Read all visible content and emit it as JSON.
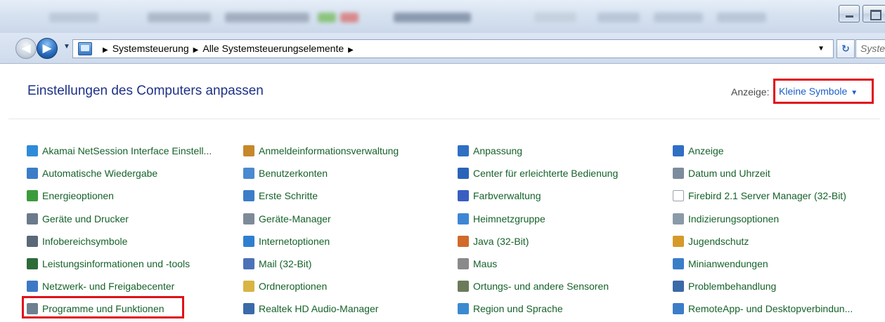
{
  "window": {
    "minimize_icon": "minimize-icon",
    "maximize_icon": "maximize-icon"
  },
  "navigation": {
    "back_glyph": "◀",
    "forward_glyph": "▶",
    "history_glyph": "▼",
    "breadcrumb": [
      "Systemsteuerung",
      "Alle Systemsteuerungselemente"
    ],
    "breadcrumb_separator": "▶",
    "address_dropdown_glyph": "▼",
    "refresh_glyph": "↻",
    "search_placeholder": "System"
  },
  "header": {
    "title": "Einstellungen des Computers anpassen",
    "view_label": "Anzeige:",
    "view_value": "Kleine Symbole",
    "view_caret": "▼"
  },
  "columns": [
    [
      {
        "label": "Akamai NetSession Interface Einstell...",
        "icon": "akamai-icon",
        "color": "#2f8bd8"
      },
      {
        "label": "Automatische Wiedergabe",
        "icon": "autoplay-icon",
        "color": "#3c7dc8"
      },
      {
        "label": "Energieoptionen",
        "icon": "power-options-icon",
        "color": "#3b9c3b"
      },
      {
        "label": "Geräte und Drucker",
        "icon": "printer-icon",
        "color": "#6b7a8c"
      },
      {
        "label": "Infobereichsymbole",
        "icon": "notification-area-icon",
        "color": "#5a6878"
      },
      {
        "label": "Leistungsinformationen und -tools",
        "icon": "performance-icon",
        "color": "#2d6b3a"
      },
      {
        "label": "Netzwerk- und Freigabecenter",
        "icon": "network-icon",
        "color": "#3d78c6"
      },
      {
        "label": "Programme und Funktionen",
        "icon": "programs-icon",
        "color": "#6e7f90"
      }
    ],
    [
      {
        "label": "Anmeldeinformationsverwaltung",
        "icon": "credential-manager-icon",
        "color": "#c6882a"
      },
      {
        "label": "Benutzerkonten",
        "icon": "user-accounts-icon",
        "color": "#4a8ad0"
      },
      {
        "label": "Erste Schritte",
        "icon": "getting-started-icon",
        "color": "#3c7dc8"
      },
      {
        "label": "Geräte-Manager",
        "icon": "device-manager-icon",
        "color": "#7d8a98"
      },
      {
        "label": "Internetoptionen",
        "icon": "internet-options-icon",
        "color": "#2f7fd0"
      },
      {
        "label": "Mail (32-Bit)",
        "icon": "mail-icon",
        "color": "#4b72b8"
      },
      {
        "label": "Ordneroptionen",
        "icon": "folder-options-icon",
        "color": "#d8b443"
      },
      {
        "label": "Realtek HD Audio-Manager",
        "icon": "realtek-audio-icon",
        "color": "#3a6aa8"
      }
    ],
    [
      {
        "label": "Anpassung",
        "icon": "personalization-icon",
        "color": "#2f6fc4"
      },
      {
        "label": "Center für erleichterte Bedienung",
        "icon": "ease-of-access-icon",
        "color": "#2a64b8"
      },
      {
        "label": "Farbverwaltung",
        "icon": "color-management-icon",
        "color": "#3a5fc0"
      },
      {
        "label": "Heimnetzgruppe",
        "icon": "homegroup-icon",
        "color": "#3d86d6"
      },
      {
        "label": "Java (32-Bit)",
        "icon": "java-icon",
        "color": "#d16a2a"
      },
      {
        "label": "Maus",
        "icon": "mouse-icon",
        "color": "#8a8a8a"
      },
      {
        "label": "Ortungs- und andere Sensoren",
        "icon": "sensors-icon",
        "color": "#6b7b5a"
      },
      {
        "label": "Region und Sprache",
        "icon": "region-language-icon",
        "color": "#3a8ad0"
      }
    ],
    [
      {
        "label": "Anzeige",
        "icon": "display-icon",
        "color": "#2f6fc4"
      },
      {
        "label": "Datum und Uhrzeit",
        "icon": "date-time-icon",
        "color": "#7c8c9c"
      },
      {
        "label": "Firebird 2.1 Server Manager (32-Bit)",
        "icon": "firebird-icon",
        "color": "#ffffff"
      },
      {
        "label": "Indizierungsoptionen",
        "icon": "indexing-options-icon",
        "color": "#8a9aa8"
      },
      {
        "label": "Jugendschutz",
        "icon": "parental-controls-icon",
        "color": "#d69a2a"
      },
      {
        "label": "Minianwendungen",
        "icon": "gadgets-icon",
        "color": "#3a7ec8"
      },
      {
        "label": "Problembehandlung",
        "icon": "troubleshooting-icon",
        "color": "#3a6aa8"
      },
      {
        "label": "RemoteApp- und Desktopverbindun...",
        "icon": "remoteapp-icon",
        "color": "#3c7dc8"
      }
    ]
  ]
}
